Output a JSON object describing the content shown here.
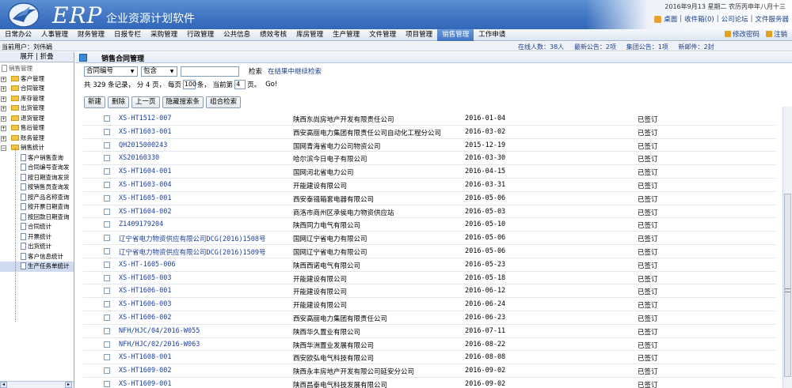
{
  "header": {
    "logo_text": "ERP",
    "subtitle": "企业资源计划软件",
    "date": "2016年9月13  星期二  农历丙申年八月十三",
    "quick_links": [
      "桌面",
      "收件箱(0)",
      "公司论坛",
      "文件服务器"
    ]
  },
  "menu": {
    "items": [
      "日常办公",
      "人事管理",
      "财务管理",
      "日报专栏",
      "采购管理",
      "行政管理",
      "公共信息",
      "绩效考核",
      "库房管理",
      "生产管理",
      "文件管理",
      "项目管理",
      "销售管理",
      "工作申请"
    ],
    "active_index": 12,
    "right": [
      "修改密码",
      "注销"
    ]
  },
  "infobar": {
    "current_user": "当前用户：刘伟娟",
    "online": "在线人数：38人",
    "notice": "最新公告：2项",
    "group_notice": "集团公告：1项",
    "mail": "新邮件：2封"
  },
  "left": {
    "toggle": "展开 | 折叠",
    "root": "销售管理",
    "folders": [
      "客户管理",
      "合同管理",
      "库存管理",
      "出货管理",
      "退货管理",
      "售后管理",
      "账务管理",
      "销售统计"
    ],
    "children": [
      "客户销售查询",
      "合同编号查询发",
      "按日期查询发货",
      "按销售员查询发",
      "按产品名称查询",
      "按开票日期查询",
      "按回款日期查询",
      "合同统计",
      "开票统计",
      "出货统计",
      "客户信息统计",
      "生产任务单统计"
    ],
    "selected_child": 11
  },
  "main": {
    "title": "销售合同管理",
    "filter": {
      "field": "合同编号",
      "op": "包含",
      "value": "",
      "search_label": "检索",
      "refine_label": "在结果中继续检索"
    },
    "paging": {
      "text1": "共 329 条记录，  分 4 页，  每页",
      "per_page": "100",
      "text2": "条，  当前第",
      "current": "4",
      "text3": "页。",
      "go": "Go!"
    },
    "buttons": [
      "新建",
      "删除",
      "上一页",
      "隐藏搜索条",
      "组合检索"
    ],
    "rows": [
      [
        "XS-HT1512-007",
        "陕西东尚房地产开发有限责任公司",
        "2016-01-04",
        "已签订"
      ],
      [
        "XS-HT1603-001",
        "西安高丽电力集团有限责任公司自动化工程分公司",
        "2016-03-02",
        "已签订"
      ],
      [
        "QH2015000243",
        "国网青海省电力公司物资公司",
        "2015-12-19",
        "已签订"
      ],
      [
        "XS20160330",
        "哈尔滨今日电子有限公司",
        "2016-03-30",
        "已签订"
      ],
      [
        "XS-HT1604-001",
        "国网河北省电力公司",
        "2016-04-15",
        "已签订"
      ],
      [
        "XS-HT1603-004",
        "开能建设有限公司",
        "2016-03-31",
        "已签订"
      ],
      [
        "XS-HT1605-001",
        "西安泰镪箱套电器有限公司",
        "2016-05-06",
        "已签订"
      ],
      [
        "XS-HT1604-002",
        "商洛市商州区承侯电力物资供应站",
        "2016-05-03",
        "已签订"
      ],
      [
        "Z1409179204",
        "陕西同力电气有限公司",
        "2016-05-10",
        "已签订"
      ],
      [
        "辽宁省电力物资供应有限公司DCG(2016)1508号",
        "国网辽宁省电力有限公司",
        "2016-05-06",
        "已签订"
      ],
      [
        "辽宁省电力物资供应有限公司DCG(2016)1509号",
        "国网辽宁省电力有限公司",
        "2016-05-06",
        "已签订"
      ],
      [
        "XS-HT-1605-006",
        "陕西西诺电气有限公司",
        "2016-05-23",
        "已签订"
      ],
      [
        "XS-HT1605-003",
        "开能建设有限公司",
        "2016-05-18",
        "已签订"
      ],
      [
        "XS-HT1606-001",
        "开能建设有限公司",
        "2016-06-12",
        "已签订"
      ],
      [
        "XS-HT1606-003",
        "开能建设有限公司",
        "2016-06-24",
        "已签订"
      ],
      [
        "XS-HT1606-002",
        "西安高丽电力集团有限责任公司",
        "2016-06-23",
        "已签订"
      ],
      [
        "NFH/HJC/04/2016-W055",
        "陕西华久置业有限公司",
        "2016-07-11",
        "已签订"
      ],
      [
        "NFH/HJC/02/2016-W063",
        "陕西华洲置业发展有限公司",
        "2016-08-22",
        "已签订"
      ],
      [
        "XS-HT1608-001",
        "西安欧弘电气科技有限公司",
        "2016-08-08",
        "已签订"
      ],
      [
        "XS-HT1609-002",
        "陕西永丰房地产开发有限公司延安分公司",
        "2016-09-02",
        "已签订"
      ],
      [
        "XS-HT1609-001",
        "陕西昌泰电气科技发展有限公司",
        "2016-09-02",
        "已签订"
      ]
    ]
  }
}
